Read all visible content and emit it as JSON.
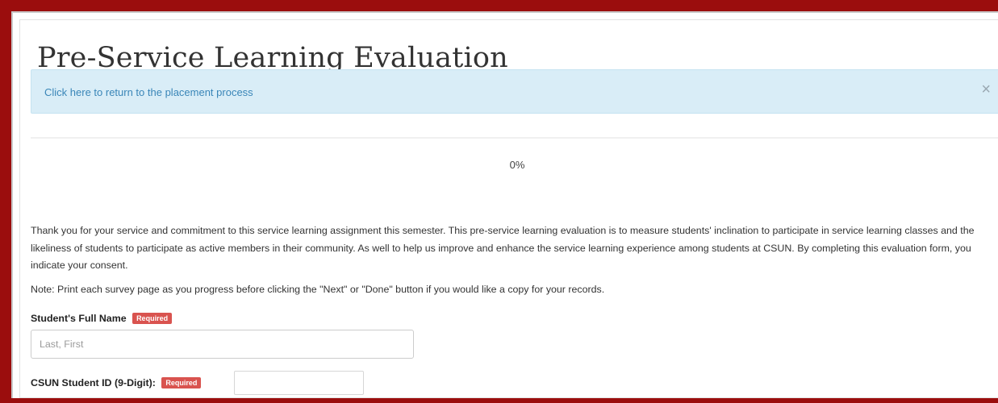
{
  "page": {
    "title": "Pre-Service Learning Evaluation"
  },
  "alert": {
    "link_text": "Click here to return to the placement process",
    "close_glyph": "×"
  },
  "progress": {
    "value": 0,
    "label": "0%"
  },
  "intro": {
    "text": "Thank you for your service and commitment to this service learning assignment this semester. This pre-service learning evaluation is to measure students' inclination to participate in service learning classes and the likeliness of students to participate as active members in their community. As well to help us improve and enhance the service learning experience among students at CSUN. By completing this evaluation form, you indicate your consent.",
    "note": "Note: Print each survey page as you progress before clicking the \"Next\" or \"Done\" button if you would like a copy for your records."
  },
  "fields": {
    "full_name": {
      "label": "Student's Full Name",
      "required_badge": "Required",
      "placeholder": "Last, First",
      "value": ""
    },
    "student_id": {
      "label": "CSUN Student ID (9-Digit):",
      "required_badge": "Required",
      "value": ""
    }
  },
  "colors": {
    "frame": "#9b0d0d",
    "alert_bg": "#d9edf7",
    "alert_link": "#3a86b8",
    "required_badge": "#d9534f"
  }
}
